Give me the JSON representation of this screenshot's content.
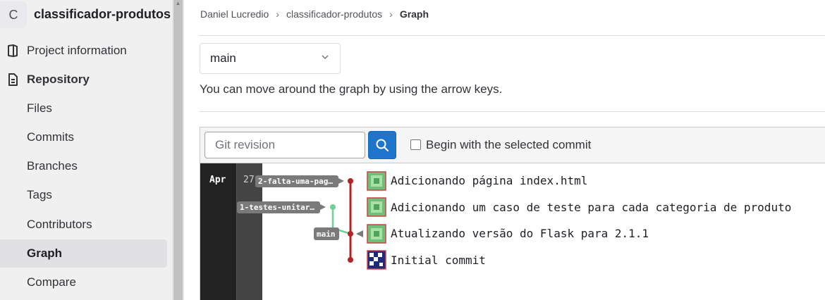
{
  "project": {
    "avatar_letter": "C",
    "name": "classificador-produtos"
  },
  "sidebar": {
    "items": [
      {
        "label": "Project information"
      },
      {
        "label": "Repository"
      },
      {
        "label": "Files"
      },
      {
        "label": "Commits"
      },
      {
        "label": "Branches"
      },
      {
        "label": "Tags"
      },
      {
        "label": "Contributors"
      },
      {
        "label": "Graph"
      },
      {
        "label": "Compare"
      }
    ]
  },
  "breadcrumb": [
    "Daniel Lucredio",
    "classificador-produtos",
    "Graph"
  ],
  "branch_select": {
    "value": "main"
  },
  "hint": "You can move around the graph by using the arrow keys.",
  "toolbar": {
    "revision_placeholder": "Git revision",
    "checkbox_label": "Begin with the selected commit",
    "checkbox_checked": false
  },
  "graph": {
    "month": "Apr",
    "day": "27",
    "commits": [
      {
        "message": "Adicionando página index.html",
        "ref": "2-falta-uma-pag…"
      },
      {
        "message": "Adicionando um caso de teste para cada categoria de produto",
        "ref": "1-testes-unitar…"
      },
      {
        "message": "Atualizando versão do Flask para 2.1.1",
        "ref": "main"
      },
      {
        "message": "Initial commit",
        "ref": ""
      }
    ],
    "colors": {
      "main_line": "#b52424",
      "branch_line": "#6fcf97",
      "tag_bg": "#7a7a7a"
    }
  }
}
